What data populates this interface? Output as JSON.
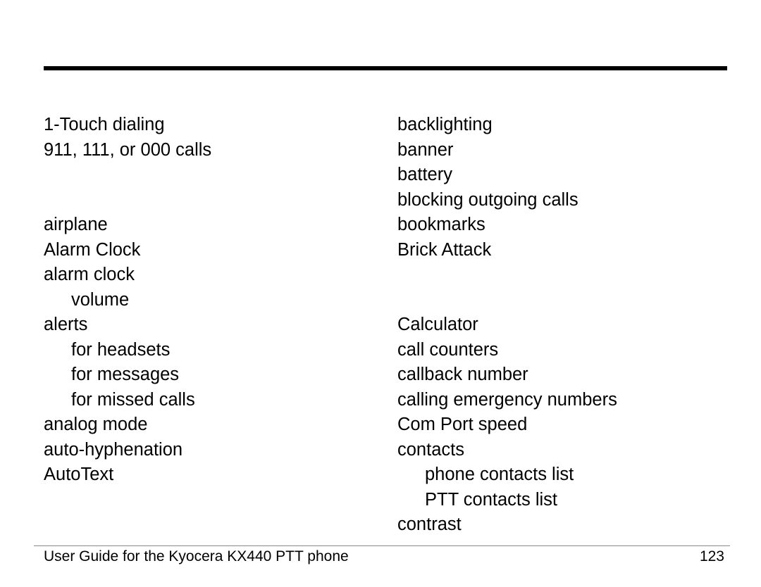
{
  "index": {
    "left_column": [
      {
        "text": "1-Touch dialing",
        "level": 0
      },
      {
        "text": "911, 111, or 000 calls",
        "level": 0
      },
      {
        "gap": true
      },
      {
        "gap": true
      },
      {
        "text": "airplane",
        "level": 0
      },
      {
        "text": "Alarm Clock",
        "level": 0
      },
      {
        "text": "alarm clock",
        "level": 0
      },
      {
        "text": "volume",
        "level": 1
      },
      {
        "text": "alerts",
        "level": 0
      },
      {
        "text": "for headsets",
        "level": 1
      },
      {
        "text": "for messages",
        "level": 1
      },
      {
        "text": "for missed calls",
        "level": 1
      },
      {
        "text": "analog mode",
        "level": 0
      },
      {
        "text": "auto-hyphenation",
        "level": 0
      },
      {
        "text": "AutoText",
        "level": 0
      }
    ],
    "right_column": [
      {
        "text": "backlighting",
        "level": 0
      },
      {
        "text": "banner",
        "level": 0
      },
      {
        "text": "battery",
        "level": 0
      },
      {
        "text": "blocking outgoing calls",
        "level": 0
      },
      {
        "text": "bookmarks",
        "level": 0
      },
      {
        "text": "Brick Attack",
        "level": 0
      },
      {
        "gap": true
      },
      {
        "gap": true
      },
      {
        "text": "Calculator",
        "level": 0
      },
      {
        "text": "call counters",
        "level": 0
      },
      {
        "text": "callback number",
        "level": 0
      },
      {
        "text": "calling emergency numbers",
        "level": 0
      },
      {
        "text": "Com Port speed",
        "level": 0
      },
      {
        "text": "contacts",
        "level": 0
      },
      {
        "text": "phone contacts list",
        "level": 1
      },
      {
        "text": "PTT contacts list",
        "level": 1
      },
      {
        "text": "contrast",
        "level": 0
      }
    ]
  },
  "footer": {
    "title": "User Guide for the Kyocera KX440 PTT phone",
    "page_number": "123"
  }
}
